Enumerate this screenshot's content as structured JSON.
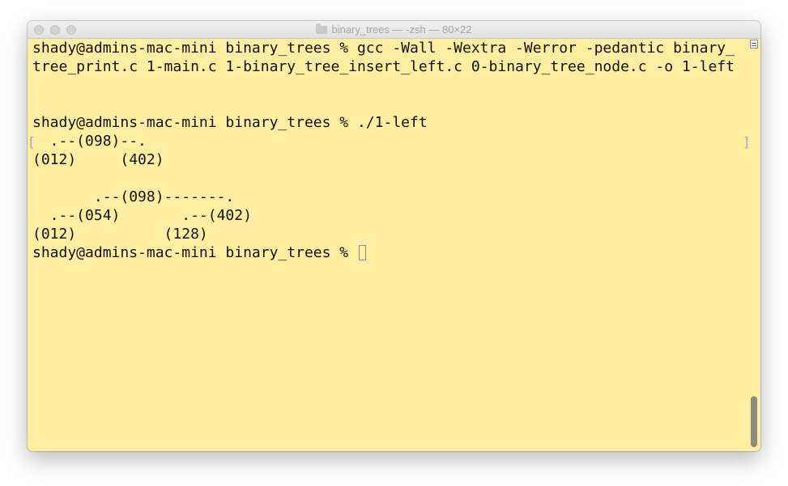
{
  "window": {
    "title": "binary_trees — -zsh — 80×22",
    "folder_icon": "folder-icon"
  },
  "terminal": {
    "lines": [
      "shady@admins-mac-mini binary_trees % gcc -Wall -Wextra -Werror -pedantic binary_",
      "tree_print.c 1-main.c 1-binary_tree_insert_left.c 0-binary_tree_node.c -o 1-left",
      "",
      "",
      "shady@admins-mac-mini binary_trees % ./1-left",
      "  .--(098)--.",
      "(012)     (402)",
      "",
      "       .--(098)-------.",
      "  .--(054)       .--(402)",
      "(012)          (128)",
      "shady@admins-mac-mini binary_trees % "
    ],
    "mark_open": "[",
    "mark_close": "]"
  },
  "colors": {
    "background": "#fdeea1",
    "text": "#111111"
  }
}
